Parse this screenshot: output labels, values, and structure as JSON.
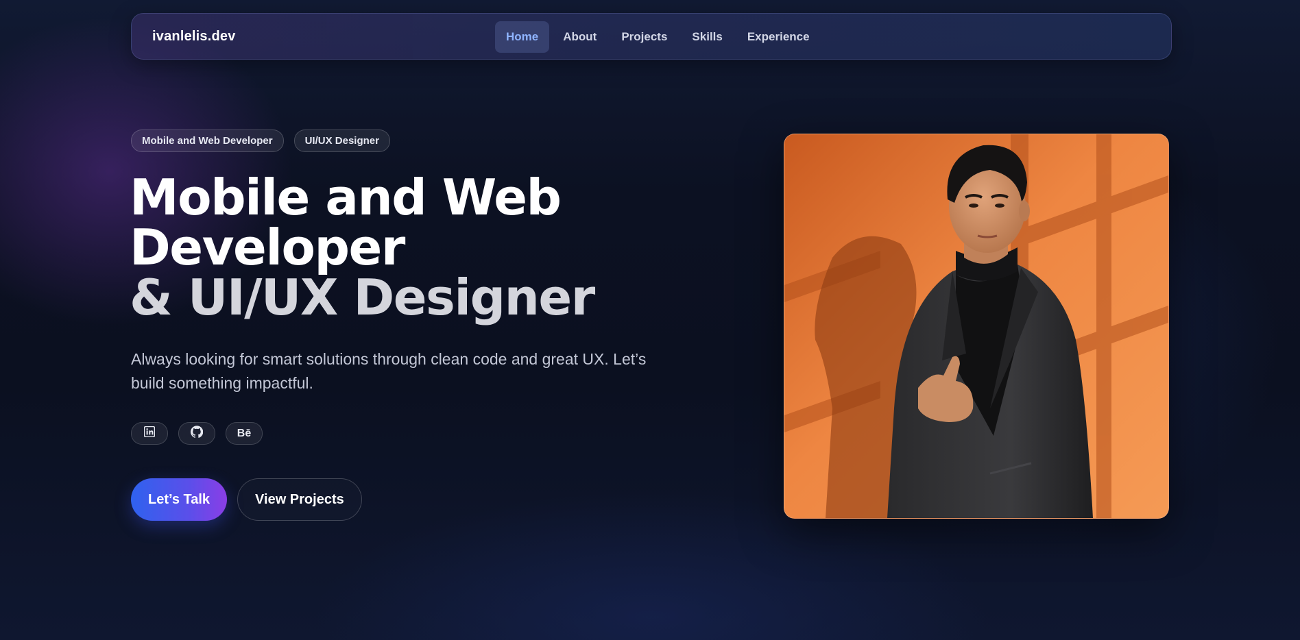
{
  "nav": {
    "logo": "ivanlelis.dev",
    "links": [
      {
        "label": "Home",
        "active": true
      },
      {
        "label": "About",
        "active": false
      },
      {
        "label": "Projects",
        "active": false
      },
      {
        "label": "Skills",
        "active": false
      },
      {
        "label": "Experience",
        "active": false
      }
    ]
  },
  "hero": {
    "tags": [
      "Mobile and Web Developer",
      "UI/UX Designer"
    ],
    "headline": {
      "line1": "Mobile and Web",
      "line2": "Developer",
      "line3": "& UI/UX Designer"
    },
    "subtitle": "Always looking for smart solutions through clean code and great UX. Let’s build something impactful.",
    "socials": [
      {
        "icon": "linkedin-icon"
      },
      {
        "icon": "github-icon"
      },
      {
        "icon": "behance-icon",
        "text": "Bē"
      }
    ],
    "primary_cta": "Let’s Talk",
    "secondary_cta": "View Projects"
  },
  "colors": {
    "accent_blue": "#2f62ee",
    "accent_purple": "#8a3ee6",
    "active_nav": "#8fb4ff",
    "background": "#0b1020",
    "portrait_background": "#ee8440"
  }
}
